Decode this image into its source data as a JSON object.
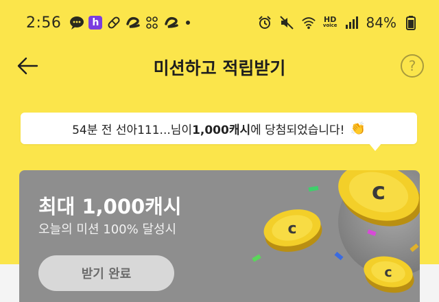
{
  "status_bar": {
    "time": "2:56",
    "battery": "84%",
    "notification_icons": [
      "chat-bubble-icon",
      "h-app-icon",
      "pill-icon",
      "swirl-icon",
      "grid-app-icon",
      "swirl-icon"
    ],
    "system_icons": [
      "alarm-icon",
      "mute-icon",
      "wifi-icon",
      "hd-voice-icon",
      "signal-icon",
      "battery-icon"
    ],
    "hd_label_top": "HD",
    "hd_label_bottom": "voice"
  },
  "header": {
    "title": "미션하고 적립받기",
    "help_label": "?"
  },
  "winner_notice": {
    "prefix": "54분 전 선아111...님이 ",
    "amount": "1,000캐시",
    "suffix": "에 당첨되었습니다!",
    "emoji": "👏"
  },
  "mission_card": {
    "title": "최대 1,000캐시",
    "subtitle": "오늘의 미션 100% 달성시",
    "button_label": "받기 완료",
    "coin_symbol": "c"
  },
  "colors": {
    "background_yellow": "#fbe54b",
    "card_gray": "#8e8e8e",
    "coin_gold": "#f3cf29"
  }
}
